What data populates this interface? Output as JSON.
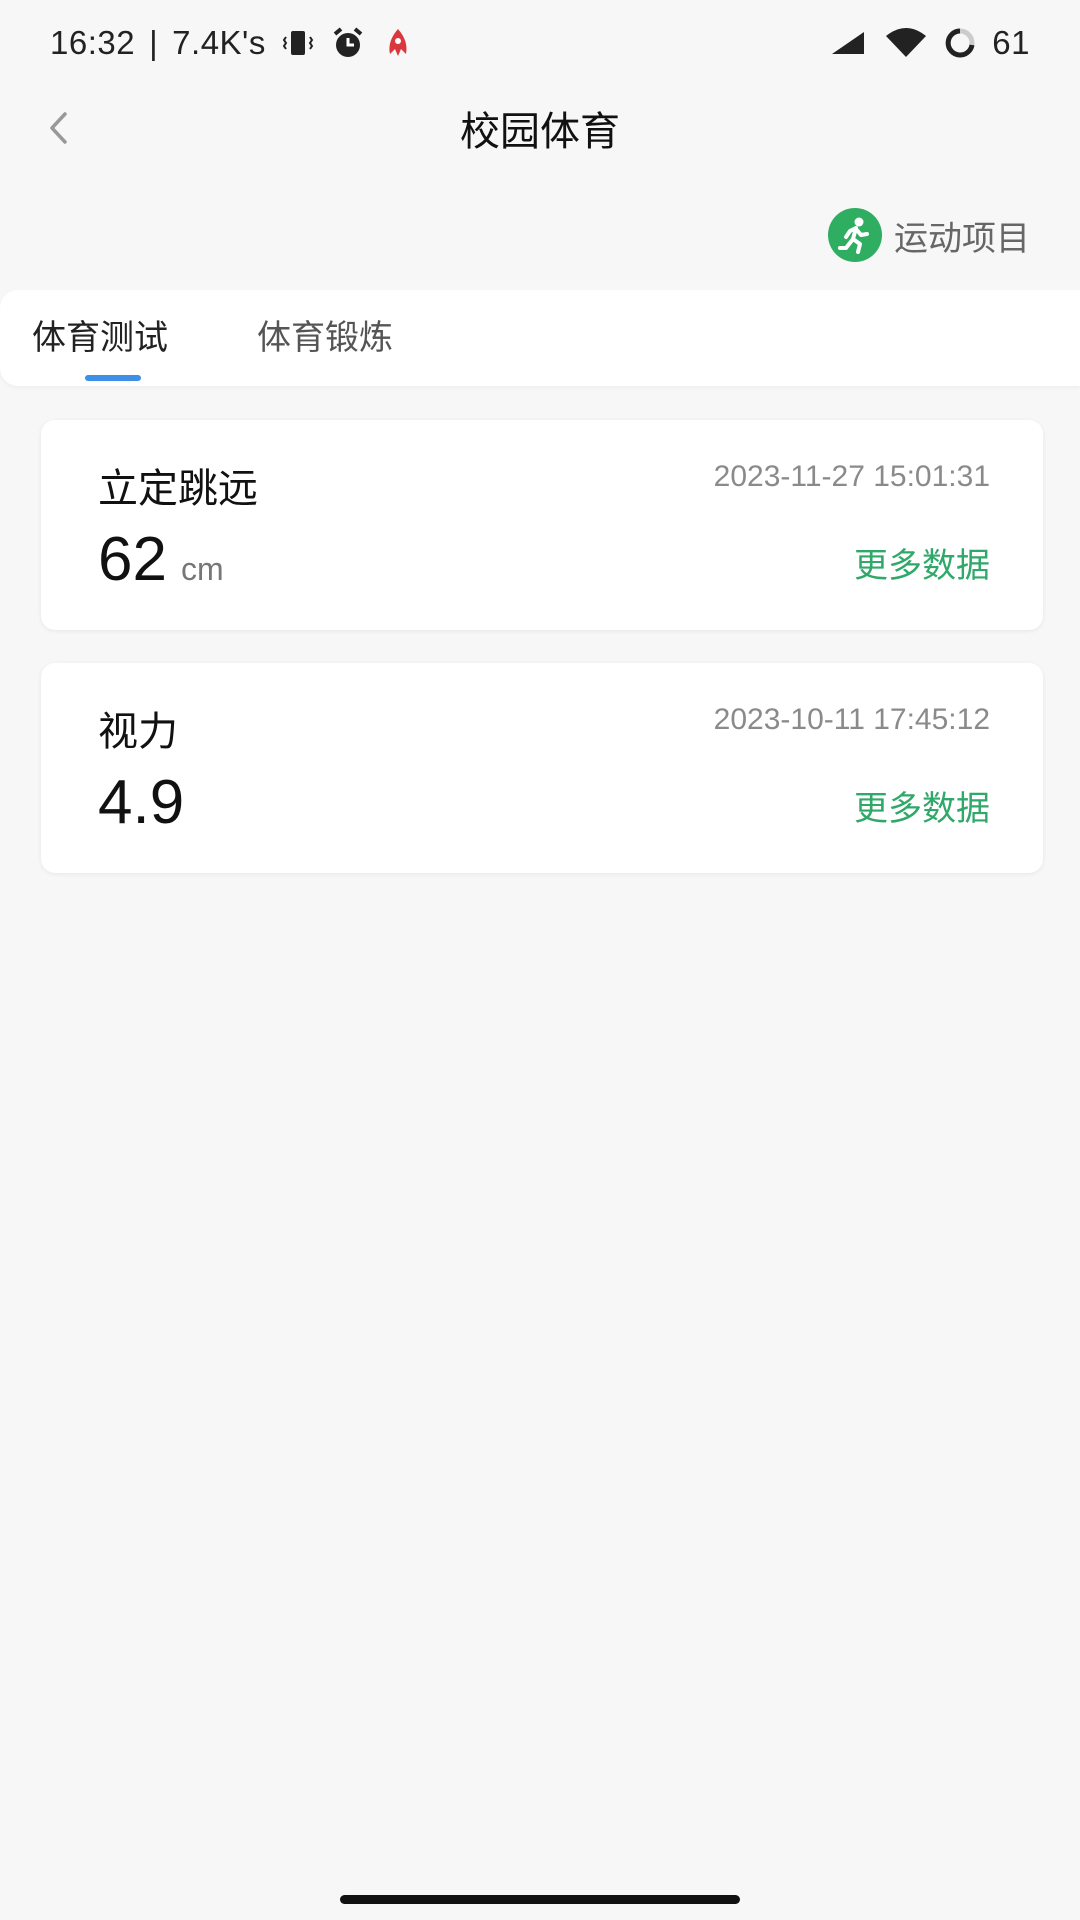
{
  "status_bar": {
    "time": "16:32",
    "separator": "|",
    "network_speed": "7.4K's",
    "battery_level": "61",
    "icons": [
      "vibrate-icon",
      "alarm-icon",
      "app-notification-icon",
      "cellular-signal-icon",
      "wifi-icon",
      "battery-icon"
    ]
  },
  "header": {
    "title": "校园体育"
  },
  "sport_items_link": {
    "label": "运动项目",
    "icon": "running-person-icon",
    "icon_color": "#2fae62"
  },
  "tabs": [
    {
      "label": "体育测试",
      "active": true
    },
    {
      "label": "体育锻炼",
      "active": false
    }
  ],
  "tab_indicator_color": "#3d8fe8",
  "records": [
    {
      "name": "立定跳远",
      "timestamp": "2023-11-27 15:01:31",
      "value": "62",
      "unit": "cm",
      "more_label": "更多数据"
    },
    {
      "name": "视力",
      "timestamp": "2023-10-11 17:45:12",
      "value": "4.9",
      "unit": "",
      "more_label": "更多数据"
    }
  ],
  "colors": {
    "accent_green": "#2fa86a",
    "background": "#f7f7f7"
  }
}
